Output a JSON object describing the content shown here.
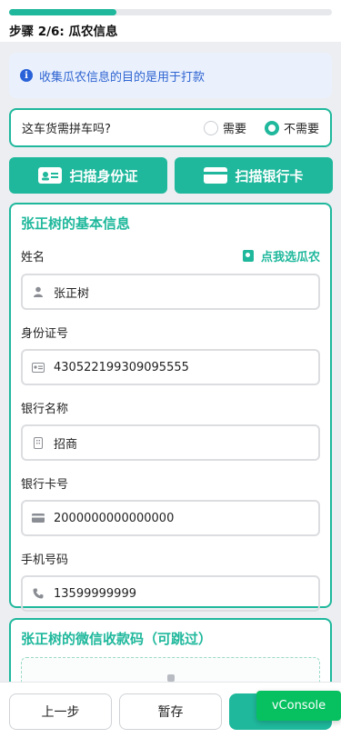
{
  "progress": {
    "step_label": "步骤 2/6: 瓜农信息",
    "fraction": 0.3333
  },
  "notice": {
    "icon": "info-icon",
    "text": "收集瓜农信息的目的是用于打款"
  },
  "carpool": {
    "question": "这车货需拼车吗?",
    "options": [
      {
        "label": "需要",
        "selected": false
      },
      {
        "label": "不需要",
        "selected": true
      }
    ]
  },
  "scan_buttons": {
    "idcard_label": "扫描身份证",
    "bank_label": "扫描银行卡"
  },
  "basic_info": {
    "title": "张正树的基本信息",
    "pick_label": "点我选瓜农",
    "fields": {
      "name": {
        "label": "姓名",
        "value": "张正树",
        "icon": "user-icon"
      },
      "id_number": {
        "label": "身份证号",
        "value": "430522199309095555",
        "icon": "id-card-icon"
      },
      "bank_name": {
        "label": "银行名称",
        "value": "招商",
        "icon": "bank-icon"
      },
      "card_number": {
        "label": "银行卡号",
        "value": "2000000000000000",
        "icon": "credit-card-icon"
      },
      "phone": {
        "label": "手机号码",
        "value": "13599999999",
        "icon": "phone-icon"
      }
    }
  },
  "wechat": {
    "title": "张正树的微信收款码（可跳过）"
  },
  "bottom": {
    "prev_label": "上一步",
    "save_label": "暂存"
  },
  "vconsole": {
    "label": "vConsole"
  },
  "colors": {
    "accent": "#1fb89c",
    "info": "#2f64d1",
    "vconsole": "#07c160"
  }
}
